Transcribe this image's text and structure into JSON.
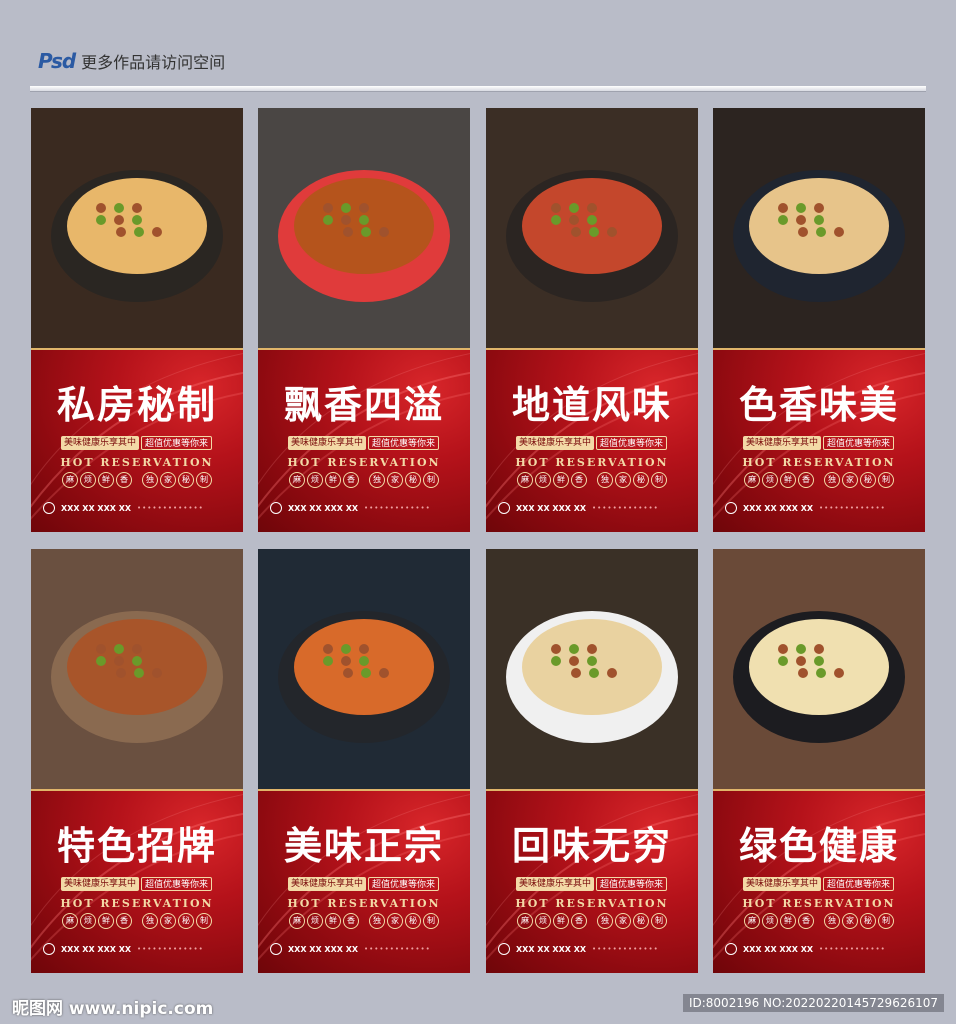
{
  "header": {
    "logo_text": "Psd",
    "caption": "更多作品请访问空间"
  },
  "cards": [
    {
      "title": "私房秘制",
      "plate": "#2a2622",
      "food": "#e8b76a",
      "bg": "#3a2a20"
    },
    {
      "title": "飘香四溢",
      "plate": "#e03b3b",
      "food": "#b5541c",
      "bg": "#4a4644"
    },
    {
      "title": "地道风味",
      "plate": "#2b2522",
      "food": "#c4472c",
      "bg": "#3b2e25"
    },
    {
      "title": "色香味美",
      "plate": "#1f2530",
      "food": "#e7c48a",
      "bg": "#2c2420"
    },
    {
      "title": "特色招牌",
      "plate": "#8a6a50",
      "food": "#a8552a",
      "bg": "#6a5040"
    },
    {
      "title": "美味正宗",
      "plate": "#23262b",
      "food": "#d86a2a",
      "bg": "#202a35"
    },
    {
      "title": "回味无穷",
      "plate": "#f0f0f0",
      "food": "#e9d2a0",
      "bg": "#3a3026"
    },
    {
      "title": "绿色健康",
      "plate": "#1c1c20",
      "food": "#f0e0b0",
      "bg": "#6a4a38"
    }
  ],
  "poster": {
    "tag_left": "美味健康乐享其中",
    "tag_right": "超值优惠等你来",
    "english": "HOT RESERVATION",
    "badges": [
      "麻",
      "烦",
      "鲜",
      "香",
      "独",
      "家",
      "秘",
      "制"
    ],
    "code": "XXX XX XXX XX"
  },
  "footer": {
    "watermark": "昵图网 www.nipic.com",
    "id_text": "ID:8002196 NO:20220220145729626107"
  }
}
